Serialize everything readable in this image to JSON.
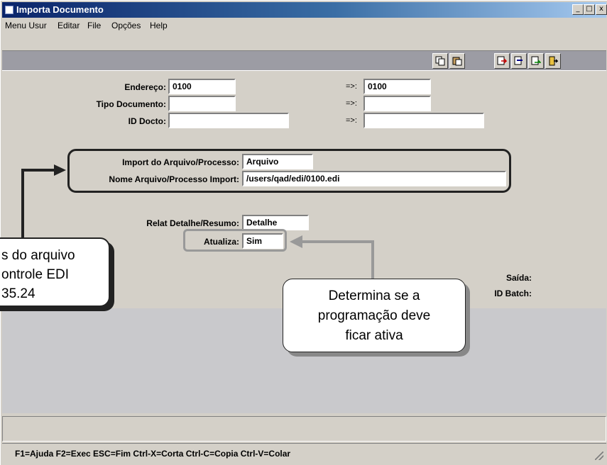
{
  "window": {
    "title": "Importa Documento",
    "min_label": "_",
    "max_label": "□",
    "close_label": "x"
  },
  "menu": [
    "Menu Usur",
    "Editar",
    "File",
    "Opções",
    "Help"
  ],
  "toolbar_icons": [
    "copy-icon",
    "paste-icon",
    "find-icon",
    "insert-icon",
    "next-icon",
    "exit-icon"
  ],
  "form": {
    "endereco": {
      "label": "Endereço:",
      "from": "0100",
      "to": "0100",
      "arrow": "=>:"
    },
    "tipo_documento": {
      "label": "Tipo Documento:",
      "from": "",
      "to": "",
      "arrow": "=>:"
    },
    "id_docto": {
      "label": "ID Docto:",
      "from": "",
      "to": "",
      "arrow": "=>:"
    },
    "import_arquivo": {
      "label": "Import do Arquivo/Processo:",
      "value": "Arquivo"
    },
    "nome_arquivo": {
      "label": "Nome Arquivo/Processo Import:",
      "value": "/users/qad/edi/0100.edi"
    },
    "relat_detalhe": {
      "label": "Relat Detalhe/Resumo:",
      "value": "Detalhe"
    },
    "atualiza": {
      "label": "Atualiza:",
      "value": "Sim"
    },
    "saida": {
      "label": "Saída:"
    },
    "id_batch": {
      "label": "ID Batch:"
    }
  },
  "status_text": "F1=Ajuda F2=Exec ESC=Fim Ctrl-X=Corta Ctrl-C=Copia Ctrl-V=Colar",
  "callouts": {
    "left": [
      "s do arquivo",
      "ontrole EDI",
      "35.24"
    ],
    "right": [
      "Determina se a",
      "programação deve",
      "ficar ativa"
    ]
  },
  "colors": {
    "title_start": "#0a246a",
    "title_end": "#a6caf0",
    "toolbar": "#9c9ca4",
    "window": "#d4d0c8"
  }
}
